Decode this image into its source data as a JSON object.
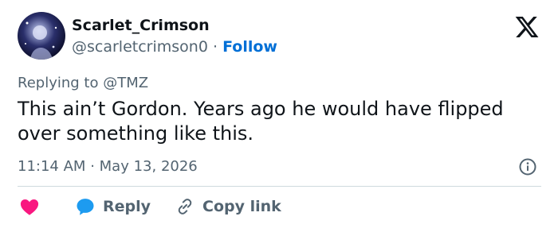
{
  "author": {
    "display_name": "Scarlet_Crimson",
    "handle": "@scarletcrimson0",
    "separator": "·",
    "follow_label": "Follow",
    "avatar_icon": "profile-avatar"
  },
  "brand": {
    "logo_icon": "x-logo-icon"
  },
  "tweet": {
    "replying_to": "Replying to @TMZ",
    "text": "This ain’t Gordon. Years ago he would have flipped over something like this.",
    "time": "11:14 AM",
    "dot": "·",
    "date": "May 13, 2026"
  },
  "actions": {
    "like_icon": "heart-icon",
    "reply_icon": "reply-bubble-icon",
    "reply_label": "Reply",
    "copy_icon": "link-icon",
    "copy_label": "Copy link"
  },
  "colors": {
    "text": "#0f1419",
    "muted": "#536471",
    "follow": "#006fd6",
    "heart": "#f91880",
    "reply_bubble": "#1d9bf0",
    "divider": "#cfd9de"
  }
}
